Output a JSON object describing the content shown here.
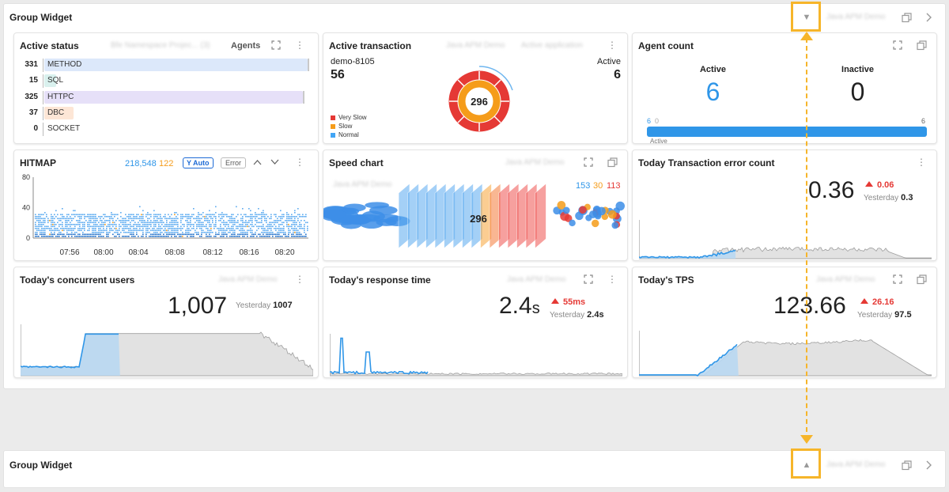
{
  "group_top": {
    "title": "Group Widget",
    "blurred": "Java APM Demo"
  },
  "group_bottom": {
    "title": "Group Widget",
    "blurred": "Java APM Demo"
  },
  "active_status": {
    "title": "Active status",
    "blurred": "Bfe Namespace Projec... (3)",
    "mode_label": "Agents",
    "rows": [
      {
        "value": "331",
        "label": "METHOD",
        "fraction": 1.0,
        "color": "#dce8fa"
      },
      {
        "value": "15",
        "label": "SQL",
        "fraction": 0.0453,
        "color": "#d9f1ee"
      },
      {
        "value": "325",
        "label": "HTTPC",
        "fraction": 0.982,
        "color": "#e6e0f8"
      },
      {
        "value": "37",
        "label": "DBC",
        "fraction": 0.112,
        "color": "#fde6d6"
      },
      {
        "value": "0",
        "label": "SOCKET",
        "fraction": 0,
        "color": "#eeeeee"
      }
    ]
  },
  "active_transaction": {
    "title": "Active transaction",
    "blurred_1": "Java APM Demo",
    "blurred_2": "Active application",
    "app_name": "demo-8105",
    "app_count": "56",
    "active_label": "Active",
    "active_value": "6",
    "center_value": "296",
    "legend": [
      {
        "label": "Very Slow",
        "color": "#e53935"
      },
      {
        "label": "Slow",
        "color": "#f59c1a"
      },
      {
        "label": "Normal",
        "color": "#42a5f5"
      }
    ]
  },
  "agent_count": {
    "title": "Agent count",
    "active_label": "Active",
    "active_value": "6",
    "inactive_label": "Inactive",
    "inactive_value": "0",
    "bar_left": "6",
    "bar_left2": "0",
    "bar_right": "6",
    "bar_caption": "Active",
    "active_fraction": 1.0,
    "active_color": "#2f96e8"
  },
  "hitmap": {
    "title": "HITMAP",
    "count_blue": "218,548",
    "count_orange": "122",
    "yauto_label": "Y Auto",
    "error_label": "Error",
    "y_ticks": [
      "80",
      "40",
      "0"
    ],
    "x_ticks": [
      "07:56",
      "08:00",
      "08:04",
      "08:08",
      "08:12",
      "08:16",
      "08:20"
    ]
  },
  "speed_chart": {
    "title": "Speed chart",
    "blurred": "Java APM Demo",
    "blurred_sub": "Java APM Demo",
    "normal_count": "153",
    "slow_count": "30",
    "very_slow_count": "113",
    "center_value": "296"
  },
  "error_count": {
    "title": "Today Transaction error count",
    "value": "0.36",
    "delta": "0.06",
    "yesterday_label": "Yesterday",
    "yesterday_value": "0.3"
  },
  "concurrent_users": {
    "title": "Today's concurrent users",
    "blurred": "Java APM Demo",
    "value": "1,007",
    "yesterday_label": "Yesterday",
    "yesterday_value": "1007"
  },
  "response_time": {
    "title": "Today's response time",
    "blurred": "Java APM Demo",
    "value": "2.4",
    "unit": "s",
    "delta": "55ms",
    "yesterday_label": "Yesterday",
    "yesterday_value": "2.4s"
  },
  "tps": {
    "title": "Today's TPS",
    "blurred": "Java APM Demo",
    "value": "123.66",
    "delta": "26.16",
    "yesterday_label": "Yesterday",
    "yesterday_value": "97.5"
  },
  "colors": {
    "blue": "#2f96e8",
    "orange": "#f59c1a",
    "red": "#e53935",
    "highlight": "#f6b52a"
  }
}
